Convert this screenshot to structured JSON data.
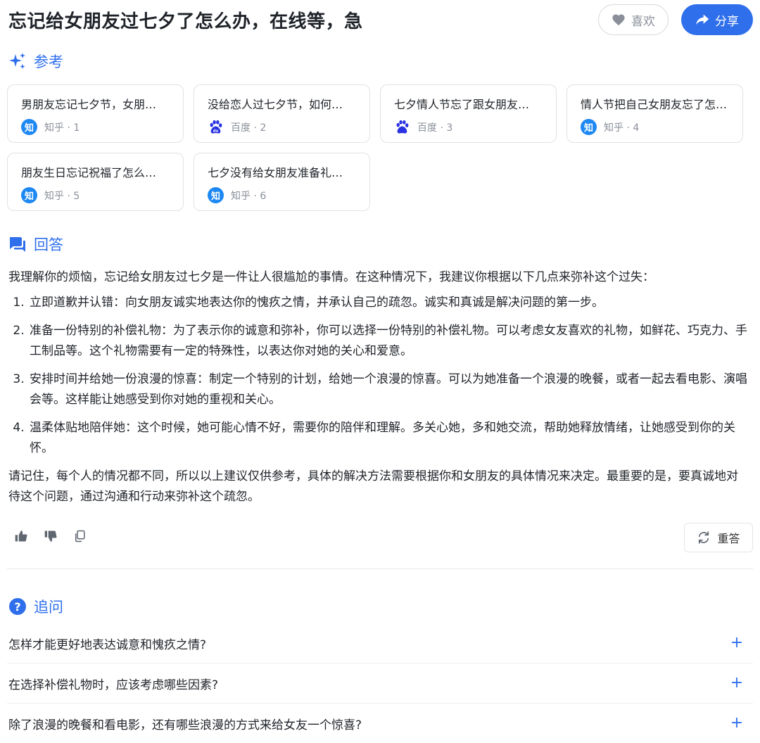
{
  "header": {
    "title": "忘记给女朋友过七夕了怎么办，在线等，急",
    "like_label": "喜欢",
    "share_label": "分享"
  },
  "references": {
    "heading": "参考",
    "items": [
      {
        "title": "男朋友忘记七夕节，女朋…",
        "source": "知乎 · 1",
        "icon": "zhihu-icon"
      },
      {
        "title": "没给恋人过七夕节，如何…",
        "source": "百度 · 2",
        "icon": "baidu-icon"
      },
      {
        "title": "七夕情人节忘了跟女朋友…",
        "source": "百度 · 3",
        "icon": "baidu-icon"
      },
      {
        "title": "情人节把自己女朋友忘了怎…",
        "source": "知乎 · 4",
        "icon": "zhihu-icon"
      },
      {
        "title": "朋友生日忘记祝福了怎么…",
        "source": "知乎 · 5",
        "icon": "zhihu-icon"
      },
      {
        "title": "七夕没有给女朋友准备礼…",
        "source": "知乎 · 6",
        "icon": "zhihu-icon"
      }
    ],
    "zhihu_glyph": "知"
  },
  "answer": {
    "heading": "回答",
    "intro": "我理解你的烦恼，忘记给女朋友过七夕是一件让人很尴尬的事情。在这种情况下，我建议你根据以下几点来弥补这个过失：",
    "points": [
      "立即道歉并认错：向女朋友诚实地表达你的愧疚之情，并承认自己的疏忽。诚实和真诚是解决问题的第一步。",
      "准备一份特别的补偿礼物：为了表示你的诚意和弥补，你可以选择一份特别的补偿礼物。可以考虑女友喜欢的礼物，如鲜花、巧克力、手工制品等。这个礼物需要有一定的特殊性，以表达你对她的关心和爱意。",
      "安排时间并给她一份浪漫的惊喜：制定一个特别的计划，给她一个浪漫的惊喜。可以为她准备一个浪漫的晚餐，或者一起去看电影、演唱会等。这样能让她感受到你对她的重视和关心。",
      "温柔体贴地陪伴她：这个时候，她可能心情不好，需要你的陪伴和理解。多关心她，多和她交流，帮助她释放情绪，让她感受到你的关怀。"
    ],
    "closing": "请记住，每个人的情况都不同，所以以上建议仅供参考，具体的解决方法需要根据你和女朋友的具体情况来决定。最重要的是，要真诚地对待这个问题，通过沟通和行动来弥补这个疏忽。",
    "regenerate_label": "重答"
  },
  "followups": {
    "heading": "追问",
    "items": [
      "怎样才能更好地表达诚意和愧疚之情?",
      "在选择补偿礼物时，应该考虑哪些因素?",
      "除了浪漫的晚餐和看电影，还有哪些浪漫的方式来给女友一个惊喜?"
    ],
    "expand_glyph": "+"
  },
  "colors": {
    "accent": "#2f6fec",
    "zhihu": "#1e88f2",
    "baidu": "#2932e1"
  }
}
